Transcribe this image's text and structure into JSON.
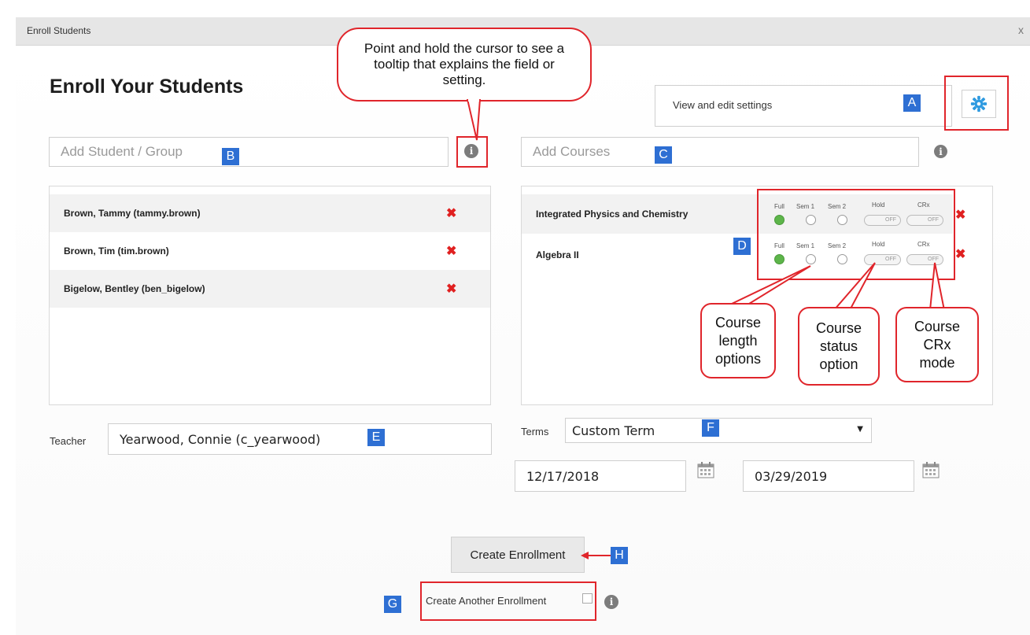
{
  "dialog": {
    "title": "Enroll Students",
    "close": "x"
  },
  "page": {
    "heading": "Enroll Your Students"
  },
  "callouts": {
    "tooltip": "Point and hold the cursor to see a tooltip that explains the field or setting.",
    "course_length": "Course length options",
    "course_status": "Course status option",
    "course_crx": "Course CRx mode"
  },
  "settings": {
    "hint": "View and edit settings",
    "icon": "gear-icon"
  },
  "badges": {
    "A": "A",
    "B": "B",
    "C": "C",
    "D": "D",
    "E": "E",
    "F": "F",
    "G": "G",
    "H": "H"
  },
  "students": {
    "placeholder": "Add Student / Group",
    "items": [
      {
        "label": "Brown, Tammy (tammy.brown)"
      },
      {
        "label": "Brown, Tim (tim.brown)"
      },
      {
        "label": "Bigelow, Bentley (ben_bigelow)"
      }
    ]
  },
  "courses": {
    "placeholder": "Add Courses",
    "option_labels": {
      "full": "Full",
      "sem1": "Sem 1",
      "sem2": "Sem 2",
      "hold": "Hold",
      "crx": "CRx"
    },
    "toggle_off": "OFF",
    "items": [
      {
        "label": "Integrated Physics and Chemistry",
        "selected": "Full"
      },
      {
        "label": "Algebra II",
        "selected": "Full"
      }
    ]
  },
  "teacher": {
    "label": "Teacher",
    "value": "Yearwood, Connie (c_yearwood)"
  },
  "terms": {
    "label": "Terms",
    "selected": "Custom Term",
    "start_date": "12/17/2018",
    "end_date": "03/29/2019"
  },
  "actions": {
    "create_enrollment": "Create Enrollment",
    "create_another": "Create Another Enrollment"
  },
  "colors": {
    "accent_red": "#e0252b",
    "badge_blue": "#2e6fd3",
    "radio_green": "#5db54a",
    "remove_red": "#e02020"
  }
}
